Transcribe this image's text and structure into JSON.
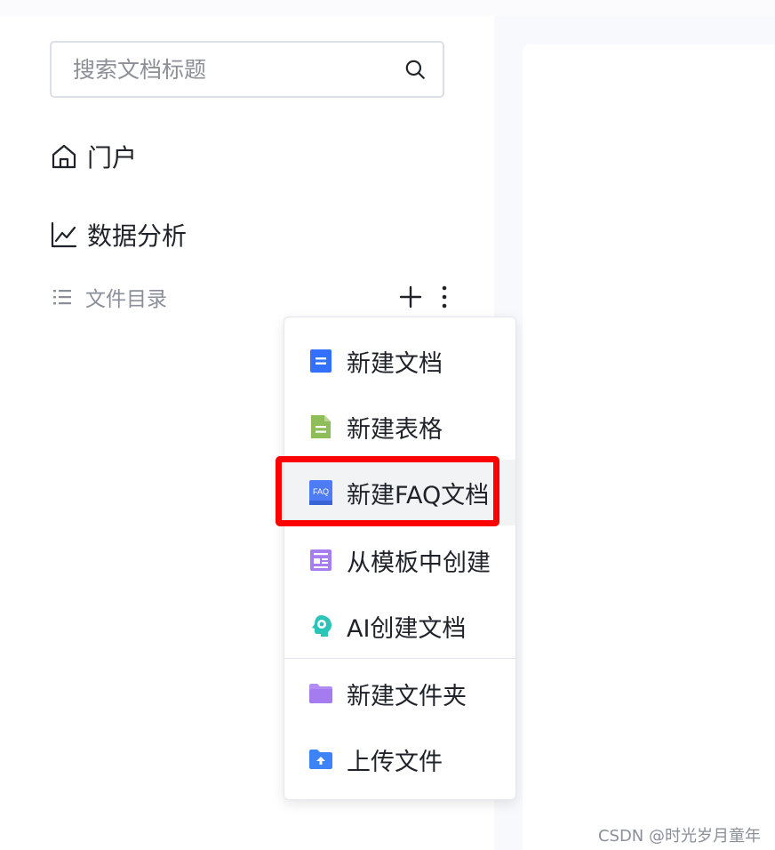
{
  "search": {
    "placeholder": "搜索文档标题",
    "icon": "search-icon"
  },
  "nav": {
    "home": {
      "label": "门户",
      "icon": "home-icon"
    },
    "analysis": {
      "label": "数据分析",
      "icon": "line-chart-icon"
    },
    "directory": {
      "label": "文件目录",
      "icon": "list-icon",
      "actions": [
        "plus-icon",
        "more-vertical-icon"
      ]
    }
  },
  "menu": {
    "items": [
      {
        "label": "新建文档",
        "icon": "doc-icon",
        "color": "#3370ff"
      },
      {
        "label": "新建表格",
        "icon": "sheet-icon",
        "color": "#8fbd5a"
      },
      {
        "label": "新建FAQ文档",
        "icon": "faq-icon",
        "color": "#4e7cf5",
        "icon_text": "FAQ"
      },
      {
        "label": "从模板中创建",
        "icon": "template-icon",
        "color": "#a77ef2"
      },
      {
        "label": "AI创建文档",
        "icon": "ai-icon",
        "color": "#2bc4b8"
      },
      {
        "label": "新建文件夹",
        "icon": "folder-icon",
        "color": "#b18cf5"
      },
      {
        "label": "上传文件",
        "icon": "upload-folder-icon",
        "color": "#3c83f6"
      }
    ]
  },
  "watermark": "CSDN @时光岁月童年",
  "colors": {
    "highlight": "#ff0000",
    "main_bg": "#f8f9fc"
  }
}
